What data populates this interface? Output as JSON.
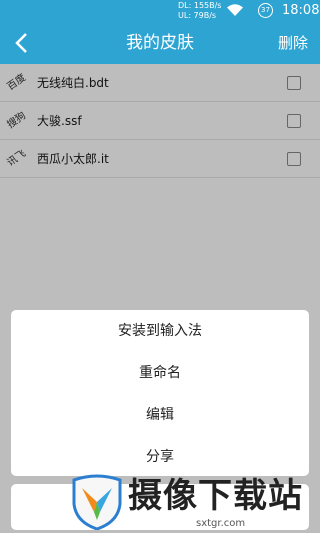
{
  "status_bar": {
    "net_down": "DL: 155B/s",
    "net_up": "UL: 79B/s",
    "battery": "37",
    "time": "18:08"
  },
  "header": {
    "title": "我的皮肤",
    "delete_label": "删除",
    "color": "#2ea4d2"
  },
  "skins": [
    {
      "source": "百度",
      "name": "无线纯白.bdt"
    },
    {
      "source": "搜狗",
      "name": "大骏.ssf"
    },
    {
      "source": "讯飞",
      "name": "西瓜小太郎.it"
    }
  ],
  "action_sheet": {
    "items": [
      "安装到输入法",
      "重命名",
      "编辑",
      "分享"
    ]
  },
  "watermark": {
    "text": "摄像下载站",
    "url": "sxtgr.com"
  }
}
